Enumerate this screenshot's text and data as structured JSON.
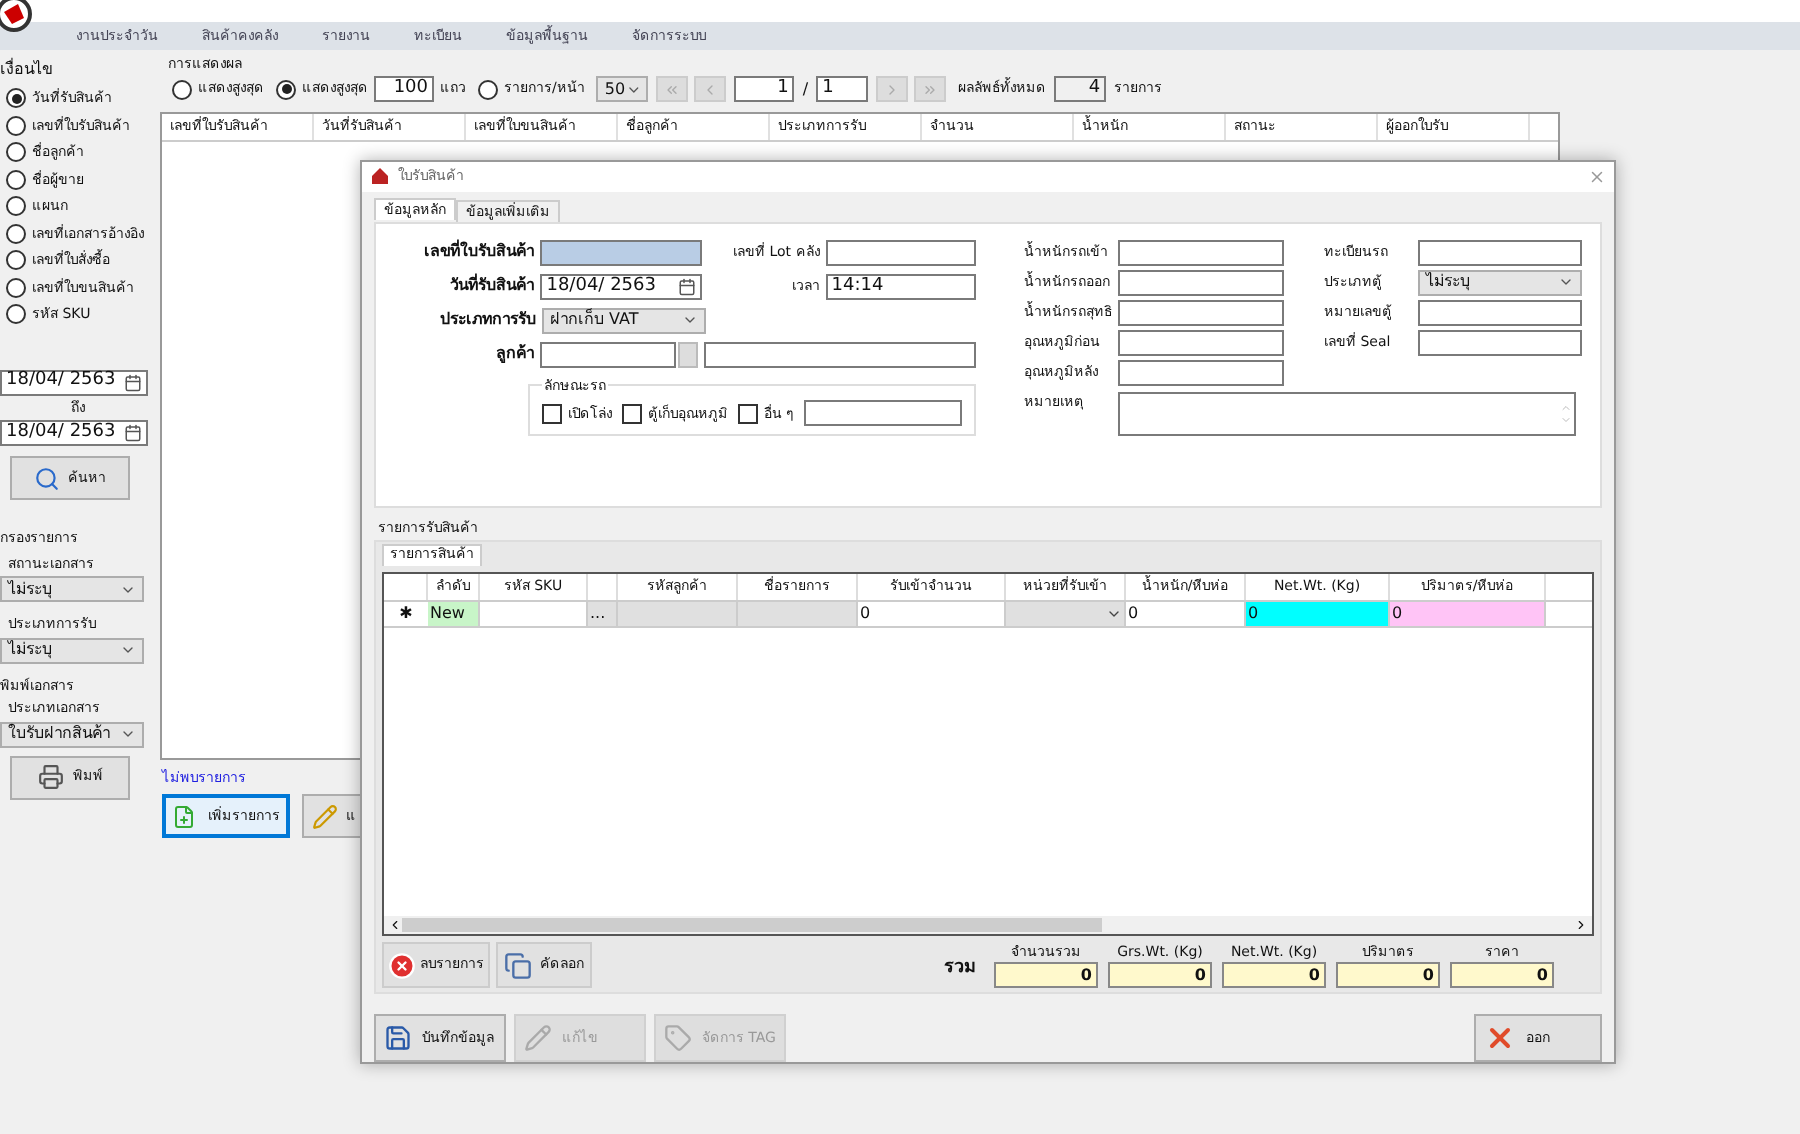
{
  "menu": [
    "งานประจำวัน",
    "สินค้าคงคลัง",
    "รายงาน",
    "ทะเบียน",
    "ข้อมูลพื้นฐาน",
    "จัดการระบบ"
  ],
  "left_panel": {
    "search_title": "เงื่อนไข",
    "options": [
      {
        "label": "วันที่รับสินค้า",
        "selected": true
      },
      {
        "label": "เลขที่ใบรับสินค้า",
        "selected": false
      },
      {
        "label": "ชื่อลูกค้า",
        "selected": false
      },
      {
        "label": "ชื่อผู้ขาย",
        "selected": false
      },
      {
        "label": "แผนก",
        "selected": false
      },
      {
        "label": "เลขที่เอกสารอ้างอิง",
        "selected": false
      },
      {
        "label": "เลขที่ใบสั่งซื้อ",
        "selected": false
      },
      {
        "label": "เลขที่ใบขนสินค้า",
        "selected": false
      },
      {
        "label": "รหัส SKU",
        "selected": false
      }
    ],
    "date_from": "18/04/ 2563",
    "to_label": "ถึง",
    "date_to": "18/04/ 2563",
    "search_button": "ค้นหา",
    "filter_title": "กรองรายการ",
    "status_label": "สถานะเอกสาร",
    "status_value": "ไม่ระบุ",
    "type_label": "ประเภทการรับ",
    "type_value": "ไม่ระบุ",
    "print_title": "พิมพ์เอกสาร",
    "doc_type_label": "ประเภทเอกสาร",
    "doc_type_value": "ใบรับฝากสินค้า",
    "print_button": "พิมพ์"
  },
  "display": {
    "title": "การแสดงผล",
    "radios": [
      {
        "label": "แสดงสูงสุด",
        "selected": false
      },
      {
        "label": "แสดงสูงสุด",
        "selected": true,
        "value": "100",
        "suffix": "แถว"
      },
      {
        "label": "รายการ/หน้า",
        "selected": false
      }
    ],
    "per_page": "50",
    "page": "1",
    "separator": "/",
    "total_pages": "1",
    "result_label": "ผลลัพธ์ทั้งหมด",
    "result_count": "4",
    "result_unit": "รายการ"
  },
  "table": {
    "columns": [
      "เลขที่ใบรับสินค้า",
      "วันที่รับสินค้า",
      "เลขที่ใบขนสินค้า",
      "ชื่อลูกค้า",
      "ประเภทการรับ",
      "จำนวน",
      "น้ำหนัก",
      "สถานะ",
      "ผู้ออกใบรับ"
    ],
    "empty_message": "ไม่พบรายการ"
  },
  "main_buttons": [
    "เพิ่มรายการ",
    "แ"
  ],
  "dialog": {
    "title": "ใบรับสินค้า",
    "tabs": [
      {
        "label": "ข้อมูลหลัก",
        "selected": true
      },
      {
        "label": "ข้อมูลเพิ่มเติม",
        "selected": false
      }
    ],
    "receipt_no_label": "เลขที่ใบรับสินค้า",
    "date_label": "วันที่รับสินค้า",
    "date_value": "18/04/ 2563",
    "type_label": "ประเภทการรับ",
    "type_value": "ฝากเก็บ VAT",
    "customer_label": "ลูกค้า",
    "lot_label": "เลขที่ Lot คลัง",
    "time_label": "เวลา",
    "time_value": "14:14",
    "truck_title": "ลักษณะรถ",
    "truck_types": [
      {
        "label": "เปิดโล่ง",
        "checked": false
      },
      {
        "label": "ตู้เก็บอุณหภูมิ",
        "checked": false
      },
      {
        "label": "อื่น ๆ",
        "checked": false
      }
    ],
    "weight_fields": [
      "น้ำหนักรถเข้า",
      "น้ำหนักรถออก",
      "น้ำหนักรถสุทธิ",
      "อุณหภูมิก่อน",
      "อุณหภูมิหลัง"
    ],
    "note_label": "หมายเหตุ",
    "truck_fields": [
      {
        "label": "ทะเบียนรถ",
        "kind": "text"
      },
      {
        "label": "ประเภทตู้",
        "kind": "select",
        "value": "ไม่ระบุ"
      },
      {
        "label": "หมายเลขตู้",
        "kind": "text"
      },
      {
        "label": "เลขที่ Seal",
        "kind": "text"
      }
    ],
    "items_title": "รายการรับสินค้า",
    "items_tab": "รายการสินค้า",
    "grid_columns": [
      {
        "label": "ลำดับ",
        "kind": "text"
      },
      {
        "label": "รหัส SKU",
        "kind": "text"
      },
      {
        "kind": "button"
      },
      {
        "label": "รหัสลูกค้า",
        "kind": "text"
      },
      {
        "label": "ชื่อรายการ",
        "kind": "text"
      },
      {
        "label": "รับเข้าจำนวน",
        "kind": "text"
      },
      {
        "label": "หน่วยที่รับเข้า",
        "kind": "text"
      },
      {
        "label": "น้ำหนัก/หีบห่อ",
        "kind": "text"
      },
      {
        "label": "Net.Wt. (Kg)",
        "kind": "text"
      },
      {
        "label": "ปริมาตร/หีบห่อ",
        "kind": "text"
      }
    ],
    "new_row": {
      "marker": "✱",
      "cells": [
        {
          "kind": "new",
          "value": "New"
        },
        {
          "kind": "input"
        },
        {
          "kind": "button",
          "value": "..."
        },
        {
          "kind": "readonly"
        },
        {
          "kind": "readonly"
        },
        {
          "kind": "input",
          "value": "0"
        },
        {
          "kind": "select"
        },
        {
          "kind": "input",
          "value": "0"
        },
        {
          "kind": "net",
          "value": "0"
        },
        {
          "kind": "volume",
          "value": "0"
        }
      ]
    },
    "grid_buttons": [
      "ลบรายการ",
      "คัดลอก"
    ],
    "total_label": "รวม",
    "totals": [
      {
        "label": "จำนวนรวม",
        "value": "0"
      },
      {
        "label": "Grs.Wt. (Kg)",
        "value": "0"
      },
      {
        "label": "Net.Wt. (Kg)",
        "value": "0"
      },
      {
        "label": "ปริมาตร",
        "value": "0"
      },
      {
        "label": "ราคา",
        "value": "0"
      }
    ],
    "footer_buttons": [
      {
        "label": "บันทึกข้อมูล",
        "kind": "save",
        "disabled": false
      },
      {
        "label": "แก้ไข",
        "kind": "edit",
        "disabled": true
      },
      {
        "label": "จัดการ TAG",
        "kind": "tag",
        "disabled": true
      },
      {
        "label": "ออก",
        "kind": "exit",
        "disabled": false
      }
    ]
  }
}
